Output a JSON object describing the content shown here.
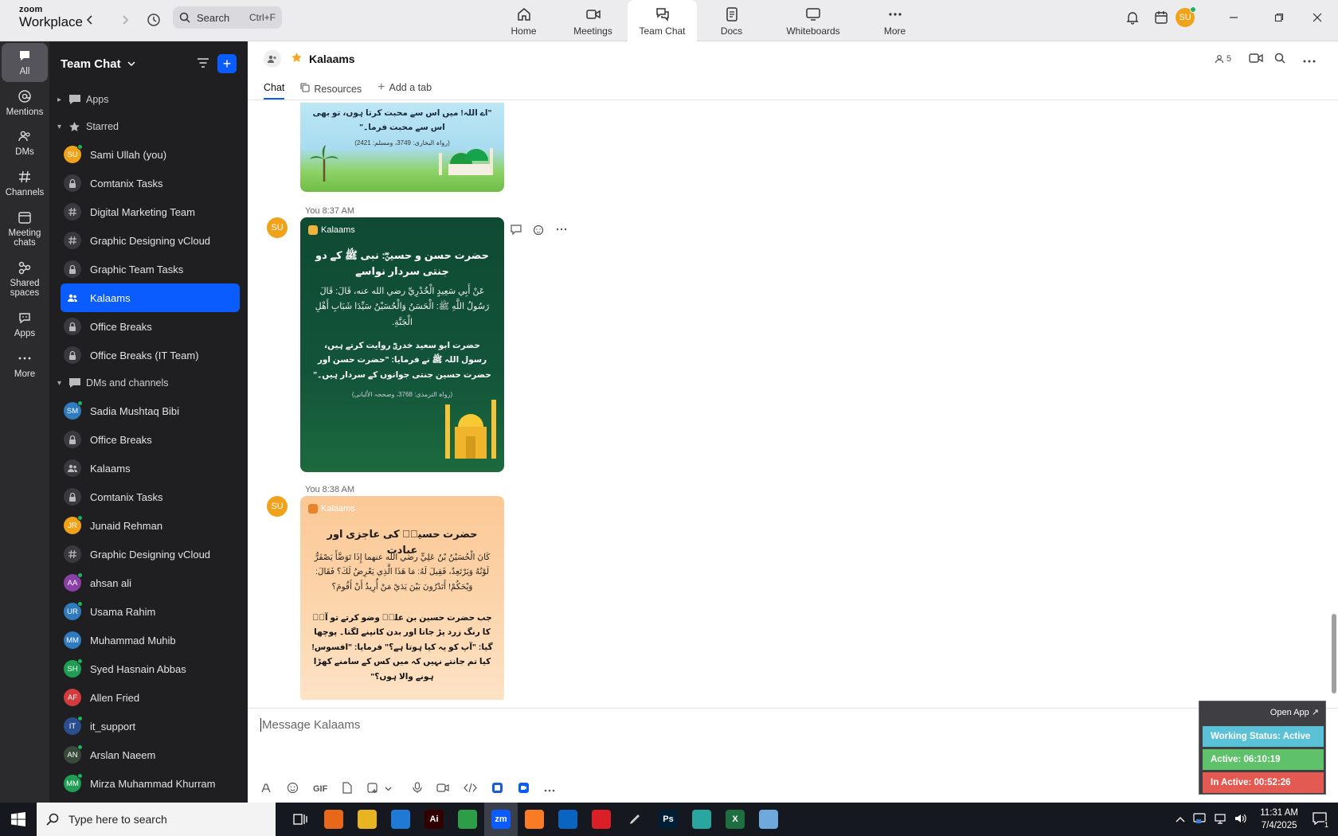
{
  "brand": {
    "line1": "zoom",
    "line2": "Workplace"
  },
  "search": {
    "label": "Search",
    "shortcut": "Ctrl+F"
  },
  "nav_tabs": [
    {
      "label": "Home",
      "icon": "home-icon"
    },
    {
      "label": "Meetings",
      "icon": "video-icon"
    },
    {
      "label": "Team Chat",
      "icon": "chat-icon",
      "active": true
    },
    {
      "label": "Docs",
      "icon": "doc-icon"
    },
    {
      "label": "Whiteboards",
      "icon": "whiteboard-icon"
    },
    {
      "label": "More",
      "icon": "more-icon"
    }
  ],
  "user_avatar": "SU",
  "rail": [
    {
      "label": "All",
      "active": true
    },
    {
      "label": "Mentions"
    },
    {
      "label": "DMs"
    },
    {
      "label": "Channels"
    },
    {
      "label": "Meeting chats"
    },
    {
      "label": "Shared spaces"
    },
    {
      "label": "Apps"
    },
    {
      "label": "More"
    }
  ],
  "sidebar": {
    "title": "Team Chat",
    "apps_label": "Apps",
    "starred_label": "Starred",
    "starred": [
      {
        "name": "Sami Ullah (you)",
        "type": "avatar",
        "initials": "SU",
        "color": "#f0a21a",
        "online": true
      },
      {
        "name": "Comtanix Tasks",
        "type": "lock"
      },
      {
        "name": "Digital Marketing Team",
        "type": "hash"
      },
      {
        "name": "Graphic Designing vCloud",
        "type": "hash"
      },
      {
        "name": "Graphic Team Tasks",
        "type": "lock"
      },
      {
        "name": "Kalaams",
        "type": "group",
        "active": true
      },
      {
        "name": "Office Breaks",
        "type": "lock"
      },
      {
        "name": "Office Breaks (IT Team)",
        "type": "lock"
      }
    ],
    "dms_label": "DMs and channels",
    "dms": [
      {
        "name": "Sadia Mushtaq Bibi",
        "type": "avatar",
        "initials": "SM",
        "color": "#2e7bbf",
        "online": true
      },
      {
        "name": "Office Breaks",
        "type": "lock"
      },
      {
        "name": "Kalaams",
        "type": "group"
      },
      {
        "name": "Comtanix Tasks",
        "type": "lock"
      },
      {
        "name": "Junaid Rehman",
        "type": "avatar",
        "initials": "JR",
        "color": "#f0a21a",
        "online": true
      },
      {
        "name": "Graphic Designing vCloud",
        "type": "hash"
      },
      {
        "name": "ahsan ali",
        "type": "avatar",
        "initials": "AA",
        "color": "#8a3fa6",
        "online": true
      },
      {
        "name": "Usama Rahim",
        "type": "avatar",
        "initials": "UR",
        "color": "#2e7bbf",
        "online": true
      },
      {
        "name": "Muhammad Muhib",
        "type": "avatar",
        "initials": "MM",
        "color": "#2e7bbf",
        "online": false
      },
      {
        "name": "Syed Hasnain Abbas",
        "type": "avatar",
        "initials": "SH",
        "color": "#1f9d55",
        "online": true
      },
      {
        "name": "Allen Fried",
        "type": "avatar",
        "initials": "AF",
        "color": "#d23c3c",
        "online": false
      },
      {
        "name": "it_support",
        "type": "avatar",
        "initials": "IT",
        "color": "#2b4e8f",
        "online": true
      },
      {
        "name": "Arslan Naeem",
        "type": "avatar",
        "initials": "AN",
        "color": "#3a4a3a",
        "online": true
      },
      {
        "name": "Mirza Muhammad Khurram",
        "type": "avatar",
        "initials": "MM",
        "color": "#1f9d55",
        "online": true
      }
    ]
  },
  "channel": {
    "name": "Kalaams",
    "member_count": "5",
    "tabs": [
      {
        "label": "Chat",
        "active": true
      },
      {
        "label": "Resources"
      },
      {
        "label": "Add a tab"
      }
    ],
    "composer_placeholder": "Message Kalaams"
  },
  "messages": [
    {
      "sender": "You",
      "time": "",
      "card": {
        "body": "\"اے اللہ! میں اس سے محبت کرتا ہوں، تو بھی اس سے محبت فرما۔\"",
        "ref": "(رواہ البخاری: 3749، ومسلم: 2421)"
      }
    },
    {
      "sender": "You",
      "time": "8:37 AM",
      "card": {
        "brand": "Kalaams",
        "title": "حضرت حسن و حسینؓ: نبی ﷺ کے دو جنتی سردار نواسے",
        "arabic": "عَنْ أَبِي سَعِيدٍ الْخُدْرِيِّ رضي الله عنه، قَالَ: قَالَ رَسُولُ اللَّهِ ﷺ: الْحَسَنُ وَالْحُسَيْنُ سَيِّدَا شَبَابِ أَهْلِ الْجَنَّةِ.",
        "urdu": "حضرت ابو سعید خدریؓ روایت کرتے ہیں، رسول اللہ ﷺ نے فرمایا: \"حضرت حسن اور حضرت حسین جنتی جوانوں کے سردار ہیں۔\"",
        "ref": "(رواہ الترمذی: 3768، وصححہ الألبانی)"
      }
    },
    {
      "sender": "You",
      "time": "8:38 AM",
      "card": {
        "brand": "Kalaams",
        "title": "حضرت حسینؓ کی عاجزی اور عبادت",
        "arabic": "كَانَ الْحُسَيْنُ بْنُ عَلِيٍّ رضي الله عنهما إِذَا تَوَضَّأَ يَصْفَرُّ لَوْنُهُ وَيَرْتَعِدُ، فَقِيلَ لَهُ: مَا هَذَا الَّذِي يَعْرِضُ لَكَ؟ فَقَالَ: وَيْحَكُمْ! أَتَدْرُونَ بَيْنَ يَدَيْ مَنْ أُرِيدُ أَنْ أَقُومَ؟",
        "urdu": "جب حضرت حسین بن علیؓ وضو کرتے تو آپؓ کا رنگ زرد پڑ جاتا اور بدن کانپنے لگتا۔ پوچھا گیا: \"آپ کو یہ کیا ہوتا ہے؟\" فرمایا: \"افسوس! کیا تم جانتے نہیں کہ میں کس کے سامنے کھڑا ہونے والا ہوں؟\""
      }
    }
  ],
  "status_widget": {
    "open_app": "Open App ↗",
    "working": "Working Status: Active",
    "active": "Active: 06:10:19",
    "inactive": "In Active: 00:52:26"
  },
  "taskbar": {
    "search_label": "Type here to search",
    "time": "11:31 AM",
    "date": "7/4/2025",
    "apps": [
      {
        "name": "task-view",
        "label": "",
        "color": "transparent"
      },
      {
        "name": "firefox",
        "label": "",
        "color": "#e8681a"
      },
      {
        "name": "file-explorer",
        "label": "",
        "color": "#e8b422"
      },
      {
        "name": "vscode",
        "label": "",
        "color": "#1e7ad6"
      },
      {
        "name": "illustrator",
        "label": "Ai",
        "color": "#330000"
      },
      {
        "name": "chrome",
        "label": "",
        "color": "#2d9d47"
      },
      {
        "name": "zoom",
        "label": "zm",
        "color": "#0b5cff",
        "active": true
      },
      {
        "name": "xampp",
        "label": "",
        "color": "#fb7a24"
      },
      {
        "name": "outlook",
        "label": "",
        "color": "#0a64c2"
      },
      {
        "name": "creative-cloud",
        "label": "",
        "color": "#da1f26"
      },
      {
        "name": "pen-tool",
        "label": "",
        "color": "transparent"
      },
      {
        "name": "photoshop",
        "label": "Ps",
        "color": "#001e36"
      },
      {
        "name": "app-diamond",
        "label": "",
        "color": "#2aa6a0"
      },
      {
        "name": "excel",
        "label": "X",
        "color": "#1d6f42"
      },
      {
        "name": "notes",
        "label": "",
        "color": "#6fa8dc"
      }
    ],
    "notification_count": "1"
  },
  "colors": {
    "accent": "#0b5cff",
    "online": "#1bb65a",
    "working": "#5bc1d6",
    "active": "#5fc26b",
    "inactive": "#e35a52"
  }
}
